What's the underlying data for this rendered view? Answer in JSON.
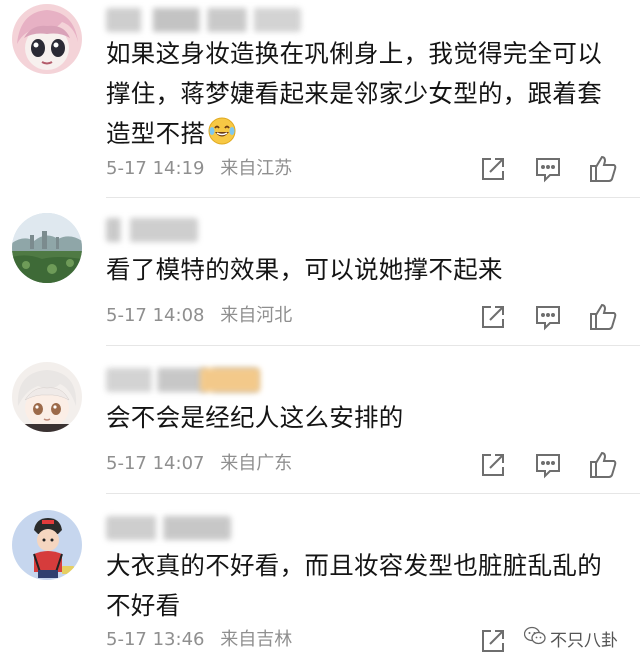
{
  "comments": [
    {
      "avatar_icon": "cartoon-girl-avatar-icon",
      "username": "",
      "text": "如果这身妆造换在巩俐身上，我觉得完全可以撑住，蒋梦婕看起来是邻家少女型的，跟着套造型不搭",
      "emoji": "laughing-tears-emoji-icon",
      "date": "5-17",
      "time": "14:19",
      "location": "来自江苏"
    },
    {
      "avatar_icon": "landscape-photo-avatar-icon",
      "username": "",
      "text": "看了模特的效果，可以说她撑不起来",
      "date": "5-17",
      "time": "14:08",
      "location": "来自河北"
    },
    {
      "avatar_icon": "anime-boy-avatar-icon",
      "username": "",
      "text": "会不会是经纪人这么安排的",
      "date": "5-17",
      "time": "14:07",
      "location": "来自广东"
    },
    {
      "avatar_icon": "cartoon-boy-avatar-icon",
      "username": "",
      "text": "大衣真的不好看，而且妆容发型也脏脏乱乱的不好看",
      "date": "5-17",
      "time": "13:46",
      "location": "来自吉林"
    }
  ],
  "actions": {
    "share_icon": "share-icon",
    "reply_icon": "reply-comment-icon",
    "like_icon": "thumbs-up-icon"
  },
  "watermark": {
    "text": "不只八卦",
    "icon": "wechat-logo-icon"
  },
  "colors": {
    "meta_text": "#8f8f8f",
    "body_text": "#141414",
    "icon_stroke": "#6e6e6e",
    "divider": "#e6e6e6"
  }
}
